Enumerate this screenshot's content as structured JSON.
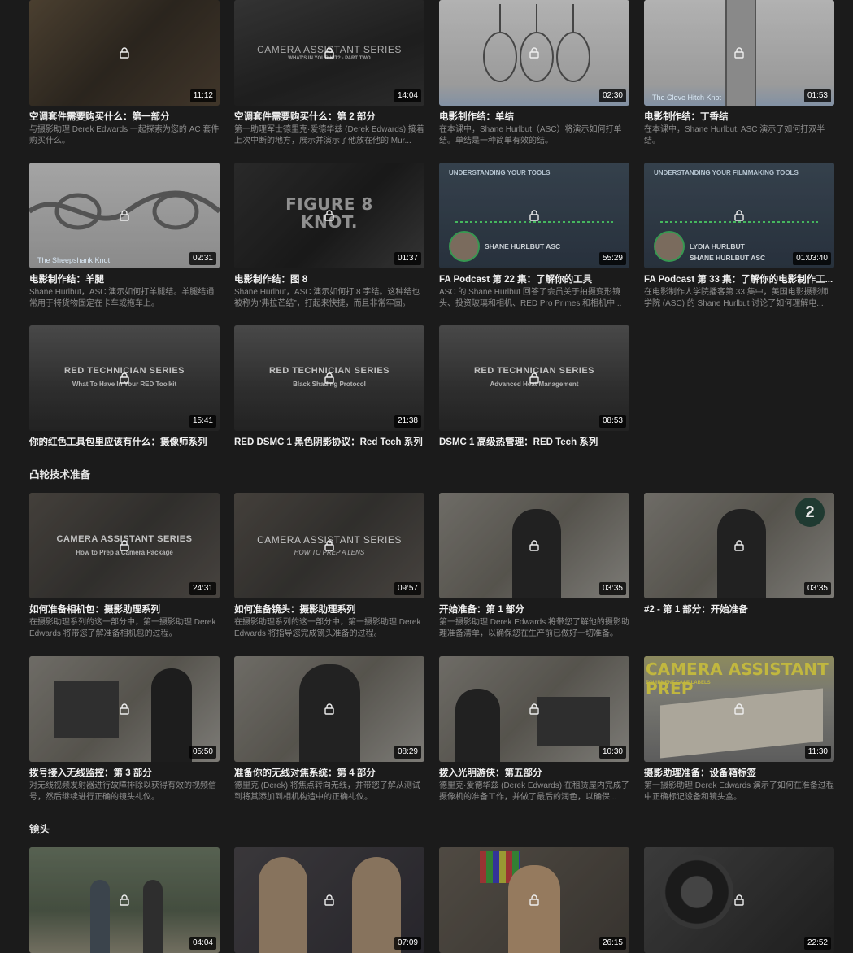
{
  "sections": [
    {
      "title": ""
    },
    {
      "title": "凸轮技术准备"
    },
    {
      "title": "镜头"
    }
  ],
  "cards": [
    {
      "title": "空调套件需要购买什么：第一部分",
      "desc": "与摄影助理 Derek Edwards 一起探索为您的 AC 套件购买什么。",
      "duration": "11:12",
      "overlay": "",
      "overlay_sub": ""
    },
    {
      "title": "空调套件需要购买什么：第 2 部分",
      "desc": "第一助理军士德里克·爱德华兹 (Derek Edwards) 接着上次中断的地方，展示并演示了他放在他的 Mur...",
      "duration": "14:04",
      "overlay": "CAMERA ASSISTANT SERIES",
      "overlay_sub": "WHAT'S IN YOUR KIT? - PART TWO"
    },
    {
      "title": "电影制作结：单结",
      "desc": "在本课中，Shane Hurlbut（ASC）将演示如何打单结。单结是一种简单有效的结。",
      "duration": "02:30",
      "overlay": "",
      "overlay_sub": ""
    },
    {
      "title": "电影制作结：丁香结",
      "desc": "在本课中，Shane Hurlbut, ASC 演示了如何打双半结。",
      "duration": "01:53",
      "overlay": "",
      "overlay_sub": "",
      "corner": "The Clove Hitch Knot"
    },
    {
      "title": "电影制作结：羊腿",
      "desc": "Shane Hurlbut，ASC 演示如何打羊腿结。羊腿结通常用于将货物固定在卡车或拖车上。",
      "duration": "02:31",
      "overlay": "",
      "overlay_sub": "",
      "corner": "The Sheepshank Knot"
    },
    {
      "title": "电影制作结：图 8",
      "desc": "Shane Hurlbut，ASC 演示如何打 8 字结。这种结也被称为“弗拉芒结”，打起来快捷，而且非常牢固。",
      "duration": "01:37",
      "overlay": "FIGURE 8 KNOT.",
      "overlay_sub": ""
    },
    {
      "title": "FA Podcast 第 22 集：了解你的工具",
      "desc": "ASC 的 Shane Hurlbut 回答了会员关于拍摄变形镜头、投资玻璃和相机、RED Pro Primes 和相机中...",
      "duration": "55:29",
      "pod_head": "UNDERSTANDING YOUR TOOLS",
      "pod_name": "SHANE HURLBUT ASC",
      "pod_name2": ""
    },
    {
      "title": "FA Podcast 第 33 集：了解你的电影制作工...",
      "desc": "在电影制作人学院播客第 33 集中，美国电影摄影师学院 (ASC) 的 Shane Hurlbut 讨论了如何理解电...",
      "duration": "01:03:40",
      "pod_head": "UNDERSTANDING YOUR FILMMAKING TOOLS",
      "pod_name": "LYDIA HURLBUT",
      "pod_name2": "SHANE HURLBUT ASC"
    },
    {
      "title": "你的红色工具包里应该有什么：摄像师系列",
      "desc": "",
      "duration": "15:41",
      "overlay": "RED TECHNICIAN SERIES",
      "overlay_sub": "What To Have In Your RED Toolkit"
    },
    {
      "title": "RED DSMC 1 黑色阴影协议：Red Tech 系列",
      "desc": "",
      "duration": "21:38",
      "overlay": "RED TECHNICIAN SERIES",
      "overlay_sub": "Black Shading Protocol"
    },
    {
      "title": "DSMC 1 高级热管理：RED Tech 系列",
      "desc": "",
      "duration": "08:53",
      "overlay": "RED TECHNICIAN SERIES",
      "overlay_sub": "Advanced Heat Management"
    },
    {
      "title": "如何准备相机包：摄影助理系列",
      "desc": "在摄影助理系列的这一部分中，第一摄影助理 Derek Edwards 将带您了解准备相机包的过程。",
      "duration": "24:31",
      "overlay": "CAMERA ASSISTANT SERIES",
      "overlay_sub": "How to Prep a Camera Package"
    },
    {
      "title": "如何准备镜头：摄影助理系列",
      "desc": "在摄影助理系列的这一部分中，第一摄影助理 Derek Edwards 将指导您完成镜头准备的过程。",
      "duration": "09:57",
      "overlay": "CAMERA ASSISTANT SERIES",
      "overlay_sub": "HOW TO PREP A LENS"
    },
    {
      "title": "开始准备：第 1 部分",
      "desc": "第一摄影助理 Derek Edwards 将带您了解他的摄影助理准备清单，以确保您在生产前已做好一切准备。",
      "duration": "03:35",
      "overlay": "",
      "overlay_sub": ""
    },
    {
      "title": "#2 - 第 1 部分：开始准备",
      "desc": "",
      "duration": "03:35",
      "overlay": "",
      "overlay_sub": "",
      "badge": "2"
    },
    {
      "title": "拨号接入无线监控：第 3 部分",
      "desc": "对无线视频发射器进行故障排除以获得有效的视频信号，然后继续进行正确的镜头礼仪。",
      "duration": "05:50",
      "overlay": "",
      "overlay_sub": ""
    },
    {
      "title": "准备你的无线对焦系统：第 4 部分",
      "desc": "德里克 (Derek) 将焦点转向无线，并带您了解从测试到将其添加到相机构造中的正确礼仪。",
      "duration": "08:29",
      "overlay": "",
      "overlay_sub": ""
    },
    {
      "title": "拨入光明游侠：第五部分",
      "desc": "德里克·爱德华兹 (Derek Edwards) 在租赁屋内完成了摄像机的准备工作，并做了最后的润色，以确保...",
      "duration": "10:30",
      "overlay": "",
      "overlay_sub": ""
    },
    {
      "title": "摄影助理准备：设备箱标签",
      "desc": "第一摄影助理 Derek Edwards 演示了如何在准备过程中正确标记设备和镜头盒。",
      "duration": "11:30",
      "overlay": "CAMERA ASSISTANT PREP",
      "overlay_sub": "EQUIPMENT CASE LABELS"
    },
    {
      "title": "",
      "desc": "",
      "duration": "04:04",
      "overlay": "",
      "overlay_sub": ""
    },
    {
      "title": "",
      "desc": "",
      "duration": "07:09",
      "overlay": "",
      "overlay_sub": ""
    },
    {
      "title": "",
      "desc": "",
      "duration": "26:15",
      "overlay": "",
      "overlay_sub": ""
    },
    {
      "title": "",
      "desc": "",
      "duration": "22:52",
      "overlay": "",
      "overlay_sub": ""
    }
  ],
  "colors": {
    "background": "#1b1b1b",
    "accent_green": "#4fd06b",
    "prep_yellow": "#e3d84a"
  },
  "icons": {
    "lock": "lock-icon"
  }
}
